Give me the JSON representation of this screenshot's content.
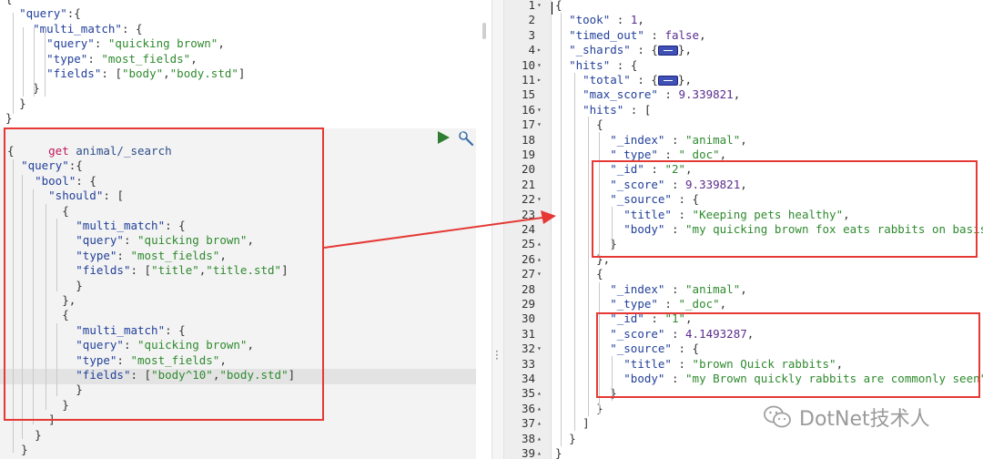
{
  "request_editor": {
    "previous_query": [
      "{",
      "  \"query\":{",
      "    \"multi_match\": {",
      "      \"query\": \"quicking brown\",",
      "      \"type\": \"most_fields\",",
      "      \"fields\": [\"body\",\"body.std\"]",
      "    }",
      "  }",
      "}"
    ],
    "method": "get",
    "endpoint": "animal/_search",
    "request_body": [
      "{",
      "  \"query\":{",
      "    \"bool\": {",
      "      \"should\": [",
      "        {",
      "          \"multi_match\": {",
      "          \"query\": \"quicking brown\",",
      "          \"type\": \"most_fields\",",
      "          \"fields\": [\"title\",\"title.std\"]",
      "          }",
      "        },",
      "        {",
      "          \"multi_match\": {",
      "          \"query\": \"quicking brown\",",
      "          \"type\": \"most_fields\",",
      "          \"fields\": [\"body^10\",\"body.std\"]",
      "          }",
      "        }",
      "      ]",
      "    }",
      "  }"
    ],
    "run_icon": "play-icon",
    "settings_icon": "wrench-icon"
  },
  "response_viewer": {
    "lines": [
      {
        "num": "1",
        "fold": "▾",
        "text": "{"
      },
      {
        "num": "2",
        "fold": "",
        "text": "  \"took\" : 1,"
      },
      {
        "num": "3",
        "fold": "",
        "text": "  \"timed_out\" : false,"
      },
      {
        "num": "4",
        "fold": "▸",
        "text": "  \"_shards\" : {",
        "collapsed": true,
        "after": "},"
      },
      {
        "num": "10",
        "fold": "▾",
        "text": "  \"hits\" : {"
      },
      {
        "num": "11",
        "fold": "▸",
        "text": "    \"total\" : {",
        "collapsed": true,
        "after": "},"
      },
      {
        "num": "15",
        "fold": "",
        "text": "    \"max_score\" : 9.339821,"
      },
      {
        "num": "16",
        "fold": "▾",
        "text": "    \"hits\" : ["
      },
      {
        "num": "17",
        "fold": "▾",
        "text": "      {"
      },
      {
        "num": "18",
        "fold": "",
        "text": "        \"_index\" : \"animal\","
      },
      {
        "num": "19",
        "fold": "",
        "text": "        \"_type\" : \"_doc\","
      },
      {
        "num": "20",
        "fold": "",
        "text": "        \"_id\" : \"2\","
      },
      {
        "num": "21",
        "fold": "",
        "text": "        \"_score\" : 9.339821,"
      },
      {
        "num": "22",
        "fold": "▾",
        "text": "        \"_source\" : {"
      },
      {
        "num": "23",
        "fold": "",
        "text": "          \"title\" : \"Keeping pets healthy\","
      },
      {
        "num": "24",
        "fold": "",
        "text": "          \"body\" : \"my quicking brown fox eats rabbits on basis\""
      },
      {
        "num": "25",
        "fold": "▴",
        "text": "        }"
      },
      {
        "num": "26",
        "fold": "▴",
        "text": "      },"
      },
      {
        "num": "27",
        "fold": "▾",
        "text": "      {"
      },
      {
        "num": "28",
        "fold": "",
        "text": "        \"_index\" : \"animal\","
      },
      {
        "num": "29",
        "fold": "",
        "text": "        \"_type\" : \"_doc\","
      },
      {
        "num": "30",
        "fold": "",
        "text": "        \"_id\" : \"1\","
      },
      {
        "num": "31",
        "fold": "",
        "text": "        \"_score\" : 4.1493287,"
      },
      {
        "num": "32",
        "fold": "▾",
        "text": "        \"_source\" : {"
      },
      {
        "num": "33",
        "fold": "",
        "text": "          \"title\" : \"brown Quick rabbits\","
      },
      {
        "num": "34",
        "fold": "",
        "text": "          \"body\" : \"my Brown quickly rabbits are commonly seen\""
      },
      {
        "num": "35",
        "fold": "▴",
        "text": "        }"
      },
      {
        "num": "36",
        "fold": "▴",
        "text": "      }"
      },
      {
        "num": "37",
        "fold": "▴",
        "text": "    ]"
      },
      {
        "num": "38",
        "fold": "▴",
        "text": "  }"
      },
      {
        "num": "39",
        "fold": "▴",
        "text": "}"
      }
    ]
  },
  "watermark": {
    "text": "DotNet技术人",
    "icon": "wechat-icon"
  },
  "colors": {
    "highlight_box": "#e53935",
    "json_key": "#22409a",
    "json_string": "#2f8a2f",
    "json_number": "#5b2d8e"
  }
}
